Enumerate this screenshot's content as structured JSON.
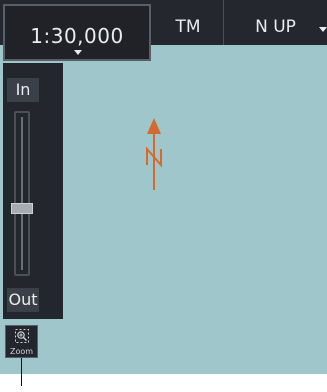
{
  "toolbar": {
    "scale_value": "1:30,000",
    "tm_label": "TM",
    "orientation_label": "N UP"
  },
  "zoom": {
    "in_label": "In",
    "out_label": "Out",
    "tool_label": "Zoom",
    "slider_level_fraction": 0.6
  },
  "icons": {
    "scale_dropdown": "chevron-down-icon",
    "orientation_dropdown": "chevron-down-icon",
    "zoom_tool": "magnifier-plus-icon",
    "north": "north-arrow-icon"
  },
  "colors": {
    "map_background": "#9fc6ca",
    "panel_background": "#23262c",
    "north_arrow": "#d46a2e"
  }
}
